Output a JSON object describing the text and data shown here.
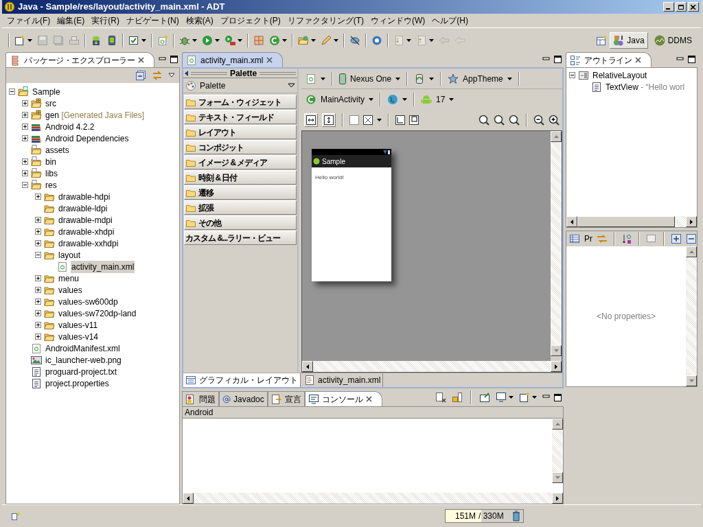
{
  "window": {
    "title": "Java - Sample/res/layout/activity_main.xml - ADT"
  },
  "menu": [
    "ファイル(F)",
    "編集(E)",
    "実行(R)",
    "ナビゲート(N)",
    "検索(A)",
    "プロジェクト(P)",
    "リファクタリング(T)",
    "ウィンドウ(W)",
    "ヘルプ(H)"
  ],
  "perspectives": [
    {
      "label": "Java",
      "selected": true
    },
    {
      "label": "DDMS",
      "selected": false
    }
  ],
  "package_explorer": {
    "title": "パッケージ・エクスプローラー",
    "tree": [
      {
        "label": "Sample",
        "kind": "project",
        "expanded": true,
        "selected": false,
        "children": [
          {
            "label": "src",
            "kind": "package",
            "expanded": false,
            "selected": false
          },
          {
            "label": "gen",
            "decoration": "[Generated Java Files]",
            "kind": "package",
            "expanded": false,
            "selected": false
          },
          {
            "label": "Android 4.2.2",
            "kind": "library",
            "expanded": false,
            "selected": false
          },
          {
            "label": "Android Dependencies",
            "kind": "library",
            "expanded": false,
            "selected": false
          },
          {
            "label": "assets",
            "kind": "source-folder",
            "selected": false
          },
          {
            "label": "bin",
            "kind": "source-folder",
            "expanded": false,
            "selected": false
          },
          {
            "label": "libs",
            "kind": "source-folder",
            "expanded": false,
            "selected": false
          },
          {
            "label": "res",
            "kind": "source-folder",
            "expanded": true,
            "selected": false,
            "children": [
              {
                "label": "drawable-hdpi",
                "kind": "folder",
                "expanded": false,
                "selected": false
              },
              {
                "label": "drawable-ldpi",
                "kind": "folder",
                "selected": false
              },
              {
                "label": "drawable-mdpi",
                "kind": "folder",
                "expanded": false,
                "selected": false
              },
              {
                "label": "drawable-xhdpi",
                "kind": "folder",
                "expanded": false,
                "selected": false
              },
              {
                "label": "drawable-xxhdpi",
                "kind": "folder",
                "expanded": false,
                "selected": false
              },
              {
                "label": "layout",
                "kind": "folder",
                "expanded": true,
                "selected": false,
                "children": [
                  {
                    "label": "activity_main.xml",
                    "kind": "xml",
                    "selected": true
                  }
                ]
              },
              {
                "label": "menu",
                "kind": "folder",
                "expanded": false,
                "selected": false
              },
              {
                "label": "values",
                "kind": "folder",
                "expanded": false,
                "selected": false
              },
              {
                "label": "values-sw600dp",
                "kind": "folder",
                "expanded": false,
                "selected": false
              },
              {
                "label": "values-sw720dp-land",
                "kind": "folder",
                "expanded": false,
                "selected": false
              },
              {
                "label": "values-v11",
                "kind": "folder",
                "expanded": false,
                "selected": false
              },
              {
                "label": "values-v14",
                "kind": "folder",
                "expanded": false,
                "selected": false
              }
            ]
          },
          {
            "label": "AndroidManifest.xml",
            "kind": "xml",
            "selected": false
          },
          {
            "label": "ic_launcher-web.png",
            "kind": "image",
            "selected": false
          },
          {
            "label": "proguard-project.txt",
            "kind": "text",
            "selected": false
          },
          {
            "label": "project.properties",
            "kind": "text",
            "selected": false
          }
        ]
      }
    ]
  },
  "editor": {
    "tab": "activity_main.xml",
    "palette": {
      "title": "Palette",
      "selector": "Palette",
      "categories": [
        "フォーム・ウィジェット",
        "テキスト・フィールド",
        "レイアウト",
        "コンポジット",
        "イメージ & メディア",
        "時刻 & 日付",
        "遷移",
        "拡張",
        "その他"
      ],
      "custom": "カスタム &...ラリー・ビュー"
    },
    "toolbar": {
      "device": "Nexus One",
      "theme": "AppTheme",
      "activity": "MainActivity",
      "api": "17"
    },
    "preview": {
      "app_title": "Sample",
      "text": "Hello world!"
    },
    "bottom_tabs": [
      {
        "label": "グラフィカル・レイアウト",
        "kind": "graphical",
        "selected": true
      },
      {
        "label": "activity_main.xml",
        "kind": "xml",
        "selected": false
      }
    ]
  },
  "outline": {
    "title": "アウトライン",
    "tree": [
      {
        "label": "RelativeLayout",
        "kind": "layout",
        "expanded": true,
        "children": [
          {
            "label": "TextView",
            "detail": " - “Hello worl",
            "kind": "text"
          }
        ]
      }
    ]
  },
  "properties": {
    "tab": "Pr",
    "empty": "<No properties>"
  },
  "console": {
    "tabs": [
      {
        "label": "問題",
        "kind": "problems",
        "selected": false
      },
      {
        "label": "Javadoc",
        "kind": "javadoc",
        "selected": false
      },
      {
        "label": "宣言",
        "kind": "declaration",
        "selected": false
      },
      {
        "label": "コンソール",
        "kind": "console",
        "selected": true
      }
    ],
    "header": "Android"
  },
  "status_bar": {
    "heap_used": "151M",
    "heap_total": "/ 330M",
    "level": 0.46
  }
}
